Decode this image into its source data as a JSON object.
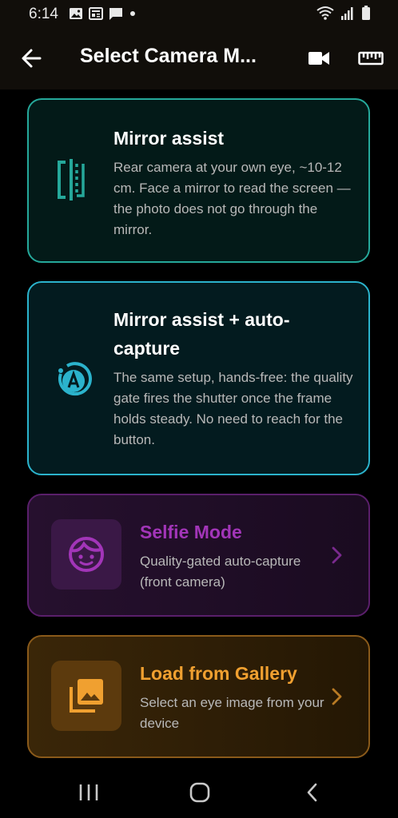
{
  "status_bar": {
    "time": "6:14",
    "left_icons": [
      "image-icon",
      "news-icon",
      "message-icon",
      "dot-icon"
    ],
    "right_icons": [
      "wifi-icon",
      "signal-icon",
      "battery-icon"
    ]
  },
  "app_bar": {
    "title": "Select Camera M...",
    "back_icon": "arrow-left-icon",
    "actions": [
      "video-camera-icon",
      "ruler-icon"
    ]
  },
  "cards": [
    {
      "title": "Mirror assist",
      "description": "Rear camera at your own eye, ~10-12 cm. Face a mirror to read the screen — the photo does not go through the mirror.",
      "icon": "mirror-split-icon",
      "accent_color": "#25a89a"
    },
    {
      "title": "Mirror assist + auto-capture",
      "description": "The same setup, hands-free: the quality gate fires the shutter once the frame holds steady. No need to reach for the button.",
      "icon": "auto-capture-icon",
      "accent_color": "#2bb3cc"
    },
    {
      "title": "Selfie Mode",
      "description": "Quality-gated auto-capture (front camera)",
      "icon": "face-icon",
      "accent_color": "#a235b8"
    },
    {
      "title": "Load from Gallery",
      "description": "Select an eye image from your device",
      "icon": "photo-library-icon",
      "accent_color": "#f0a030"
    }
  ],
  "nav_bar": {
    "icons": [
      "recents-icon",
      "home-icon",
      "back-icon"
    ]
  }
}
